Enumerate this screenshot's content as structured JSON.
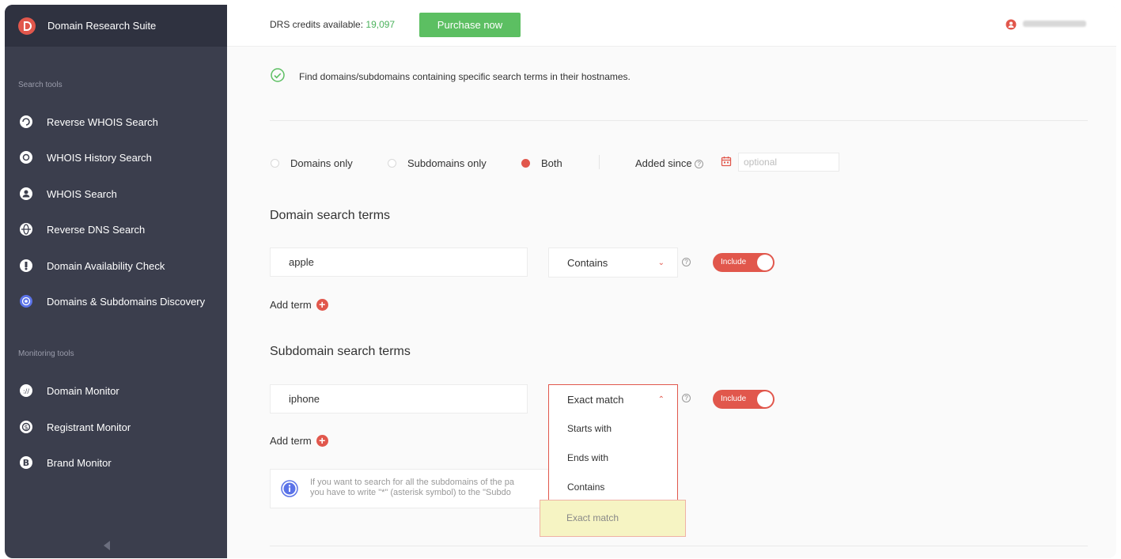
{
  "app": {
    "title": "Domain Research Suite"
  },
  "header": {
    "credits_label": "DRS credits available:",
    "credits_value": "19,097",
    "purchase_label": "Purchase now"
  },
  "sidebar": {
    "search_tools_label": "Search tools",
    "monitoring_tools_label": "Monitoring tools",
    "search_items": [
      {
        "label": "Reverse WHOIS Search",
        "icon": "reverse-whois-icon"
      },
      {
        "label": "WHOIS History Search",
        "icon": "history-icon"
      },
      {
        "label": "WHOIS Search",
        "icon": "user-circle-icon"
      },
      {
        "label": "Reverse DNS Search",
        "icon": "globe-icon"
      },
      {
        "label": "Domain Availability Check",
        "icon": "availability-icon"
      },
      {
        "label": "Domains & Subdomains Discovery",
        "icon": "discovery-icon",
        "active": true
      }
    ],
    "monitoring_items": [
      {
        "label": "Domain Monitor",
        "icon": "domain-monitor-icon"
      },
      {
        "label": "Registrant Monitor",
        "icon": "registrant-monitor-icon"
      },
      {
        "label": "Brand Monitor",
        "icon": "brand-monitor-icon"
      }
    ]
  },
  "main": {
    "intro": "Find domains/subdomains containing specific search terms in their hostnames.",
    "scope": {
      "options": [
        "Domains only",
        "Subdomains only",
        "Both"
      ],
      "selected": "Both"
    },
    "added_since_label": "Added since",
    "added_since_placeholder": "optional",
    "domain_section": {
      "heading": "Domain search terms",
      "term": "apple",
      "match": "Contains",
      "toggle": "Include",
      "add_term": "Add term"
    },
    "subdomain_section": {
      "heading": "Subdomain search terms",
      "term": "iphone",
      "match": "Exact match",
      "toggle": "Include",
      "add_term": "Add term",
      "dropdown_options": [
        "Starts with",
        "Ends with",
        "Contains",
        "Exact match"
      ]
    },
    "info_line1": "If you want to search for all the subdomains of the pa",
    "info_line2": "you have to write \"*\" (asterisk symbol) to the \"Subdo"
  },
  "colors": {
    "accent": "#e1574c",
    "success": "#5cbf62",
    "sidebar": "#3b3e4d"
  }
}
